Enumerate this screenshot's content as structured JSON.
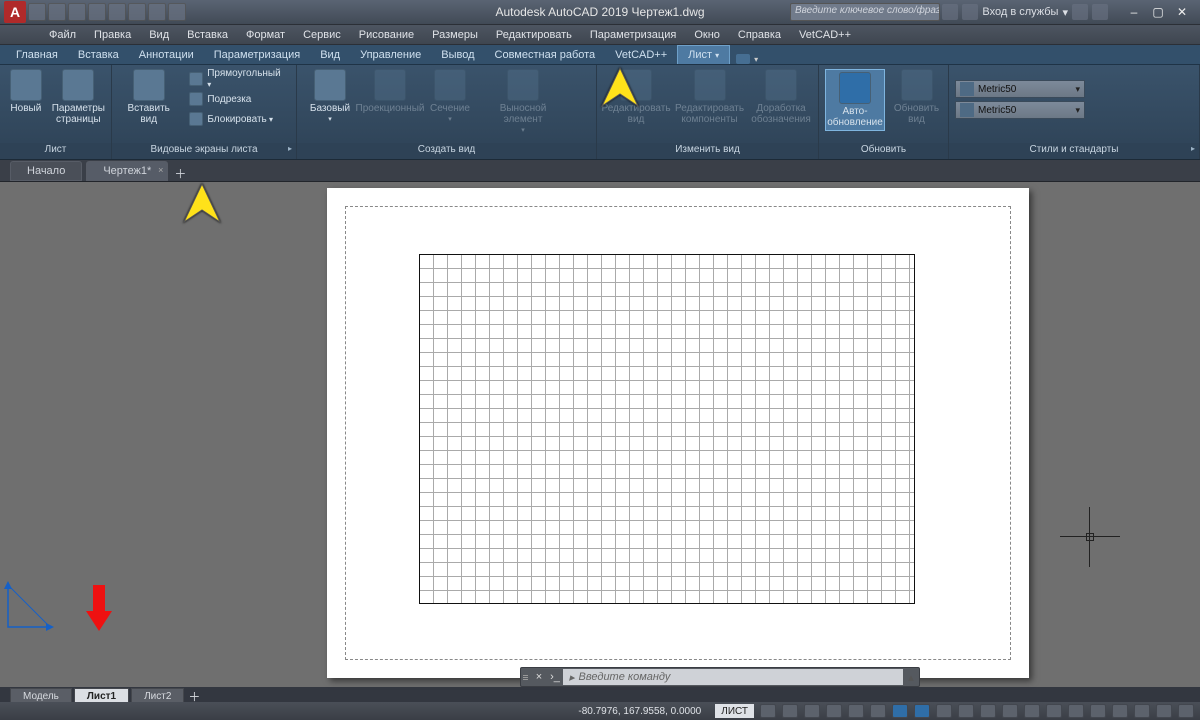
{
  "title": "Autodesk AutoCAD 2019    Чертеж1.dwg",
  "search_placeholder": "Введите ключевое слово/фразу",
  "signin": "Вход в службы",
  "menus": [
    "Файл",
    "Правка",
    "Вид",
    "Вставка",
    "Формат",
    "Сервис",
    "Рисование",
    "Размеры",
    "Редактировать",
    "Параметризация",
    "Окно",
    "Справка",
    "VetCAD++"
  ],
  "ribtabs": [
    "Главная",
    "Вставка",
    "Аннотации",
    "Параметризация",
    "Вид",
    "Управление",
    "Вывод",
    "Совместная работа",
    "VetCAD++",
    "Лист"
  ],
  "active_ribtab": 9,
  "panel_list": {
    "name": "Лист",
    "new": "Новый",
    "pageparams": "Параметры\nстраницы"
  },
  "panel_vp": {
    "name": "Видовые экраны листа",
    "insertview": "Вставить вид",
    "rect": "Прямоугольный",
    "clip": "Подрезка",
    "lock": "Блокировать"
  },
  "panel_create": {
    "name": "Создать вид",
    "base": "Базовый",
    "proj": "Проекционный",
    "section": "Сечение",
    "detail": "Выносной элемент"
  },
  "panel_modify": {
    "name": "Изменить вид",
    "editview": "Редактировать\nвид",
    "editcomp": "Редактировать\nкомпоненты",
    "symupdate": "Доработка\nобозначения"
  },
  "panel_update": {
    "name": "Обновить",
    "auto": "Авто-\nобновление",
    "updview": "Обновить\nвид"
  },
  "panel_styles": {
    "name": "Стили и стандарты",
    "combo1": "Metric50",
    "combo2": "Metric50"
  },
  "doctabs": {
    "start": "Начало",
    "drawing": "Чертеж1*"
  },
  "command_placeholder": "Введите команду",
  "layout_tabs": [
    "Модель",
    "Лист1",
    "Лист2"
  ],
  "active_layout": 1,
  "coords": "-80.7976, 167.9558, 0.0000",
  "mode": "ЛИСТ"
}
